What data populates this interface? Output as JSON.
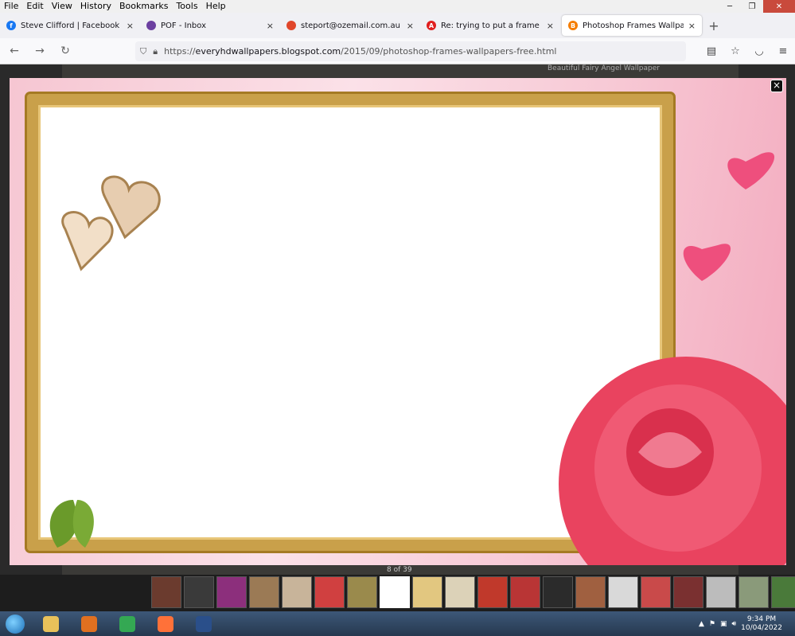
{
  "menu": [
    "File",
    "Edit",
    "View",
    "History",
    "Bookmarks",
    "Tools",
    "Help"
  ],
  "tabs": [
    {
      "title": "Steve Clifford | Facebook",
      "icon": "facebook-icon",
      "color": "#1877f2",
      "glyph": "f",
      "active": false
    },
    {
      "title": "POF - Inbox",
      "icon": "pof-icon",
      "color": "#6b3fa0",
      "glyph": "",
      "active": false
    },
    {
      "title": "steport@ozemail.com.au - Web",
      "icon": "webmail-icon",
      "color": "#e0462a",
      "glyph": "",
      "active": false
    },
    {
      "title": "Re: trying to put a frame around",
      "icon": "adobe-icon",
      "color": "#e01e1e",
      "glyph": "A",
      "active": false
    },
    {
      "title": "Photoshop Frames Wallpapers F",
      "icon": "blogger-icon",
      "color": "#f57d00",
      "glyph": "B",
      "active": true
    }
  ],
  "tab_close": "×",
  "new_tab": "+",
  "url": {
    "prefix": "https://",
    "domain": "everyhdwallpapers.blogspot.com",
    "path": "/2015/09/photoshop-frames-wallpapers-free.html"
  },
  "bg_hint": "Beautiful Fairy Angel Wallpaper",
  "lightbox_close": "×",
  "counter": "8 of 39",
  "thumbs": [
    "#6b3b2e",
    "#3a3a3a",
    "#8c2f7c",
    "#9b7a55",
    "#c8b49a",
    "#d04040",
    "#9a8a4c",
    "#ffffff",
    "#e2c780",
    "#dcd2b8",
    "#c0392b",
    "#b93535",
    "#2b2b2b",
    "#a06040",
    "#d9d9d9",
    "#c94a4a",
    "#7a3030",
    "#bcbcbc",
    "#8a9a7a",
    "#4a7a3a"
  ],
  "current_thumb": 7,
  "taskbar_apps": [
    {
      "name": "explorer-icon",
      "color": "#e8c15a"
    },
    {
      "name": "media-player-icon",
      "color": "#e07020"
    },
    {
      "name": "chrome-icon",
      "color": "#34a853"
    },
    {
      "name": "firefox-icon",
      "color": "#ff7139"
    },
    {
      "name": "photoshop-elements-icon",
      "color": "#2a4f8a"
    }
  ],
  "clock": {
    "time": "9:34 PM",
    "date": "10/04/2022"
  },
  "tray_arrow": "▲"
}
